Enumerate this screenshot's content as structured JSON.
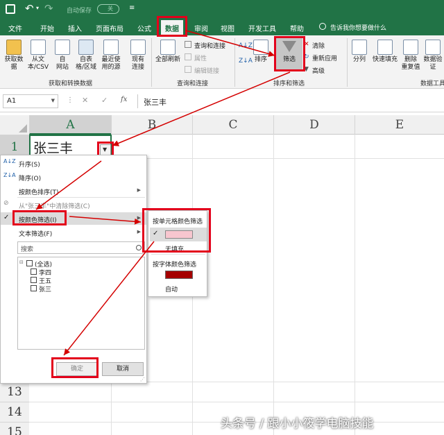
{
  "title_bar": {
    "autosave_label": "自动保存",
    "autosave_state": "关"
  },
  "menu": {
    "tabs": [
      "文件",
      "开始",
      "插入",
      "页面布局",
      "公式",
      "数据",
      "审阅",
      "视图",
      "开发工具",
      "帮助"
    ],
    "active_tab": "数据",
    "tell_me": "告诉我你想要做什么"
  },
  "ribbon": {
    "get_transform": {
      "buttons": [
        "获取数\n据",
        "从文\n本/CSV",
        "自\n网站",
        "自表\n格/区域",
        "最近使\n用的源",
        "现有\n连接"
      ],
      "label": "获取和转换数据"
    },
    "queries": {
      "refresh": "全部刷新",
      "items": [
        "查询和连接",
        "属性",
        "编辑链接"
      ],
      "label": "查询和连接"
    },
    "sort_filter": {
      "sort": "排序",
      "filter": "筛选",
      "items": [
        "清除",
        "重新应用",
        "高级"
      ],
      "label": "排序和筛选"
    },
    "data_tools": {
      "buttons": [
        "分列",
        "快速填充",
        "删除\n重复值",
        "数据验\n证"
      ],
      "label": "数据工具"
    }
  },
  "formula_bar": {
    "name_box": "A1",
    "fx": "fx",
    "content": "张三丰"
  },
  "sheet": {
    "columns": [
      "A",
      "B",
      "C",
      "D",
      "E"
    ],
    "rows": [
      "1",
      "13",
      "14",
      "15"
    ],
    "cell_a1": "张三丰"
  },
  "filter_dropdown": {
    "items": [
      "升序(S)",
      "降序(O)",
      "按颜色排序(T)",
      "从\"张三丰\"中清除筛选(C)",
      "按颜色筛选(I)",
      "文本筛选(F)"
    ],
    "search_placeholder": "搜索",
    "checklist": [
      "(全选)",
      "李四",
      "王五",
      "张三"
    ],
    "ok": "确定",
    "cancel": "取消"
  },
  "color_submenu": {
    "cell_color_title": "按单元格颜色筛选",
    "no_fill": "无填充",
    "font_color_title": "按字体颜色筛选",
    "auto": "自动",
    "cell_swatch_color": "#f7c6cf",
    "font_swatch_color": "#a50000"
  },
  "watermark": "头条号 / 跟小小筱学电脑技能"
}
